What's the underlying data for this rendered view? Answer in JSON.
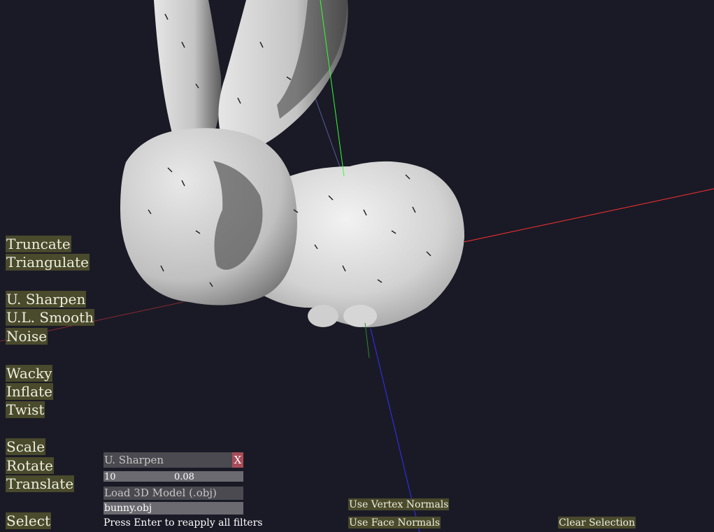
{
  "colors": {
    "background": "#1a1a26",
    "button_bg": "#4a4a2c",
    "button_text": "#eeeee0",
    "panel_header_bg": "#4a4a50",
    "panel_field_bg": "#6a6a70",
    "close_bg": "#a84c58",
    "axis_x": "#ff3030",
    "axis_y": "#30ff30",
    "axis_z": "#3030ff"
  },
  "menu": {
    "truncate": "Truncate",
    "triangulate": "Triangulate",
    "u_sharpen": "U. Sharpen",
    "ul_smooth": "U.L. Smooth",
    "noise": "Noise",
    "wacky": "Wacky",
    "inflate": "Inflate",
    "twist": "Twist",
    "scale": "Scale",
    "rotate": "Rotate",
    "translate": "Translate",
    "select": "Select"
  },
  "filter_panel": {
    "title": "U. Sharpen",
    "close": "X",
    "param1": "10",
    "param2": "0.08"
  },
  "loader": {
    "label": "Load 3D Model (.obj)",
    "filename": "bunny.obj"
  },
  "hint": "Press Enter to reapply all filters",
  "bottom": {
    "vertex_normals": "Use Vertex Normals",
    "face_normals": "Use Face Normals",
    "clear_selection": "Clear Selection"
  },
  "model": {
    "icon": "bunny-mesh"
  }
}
